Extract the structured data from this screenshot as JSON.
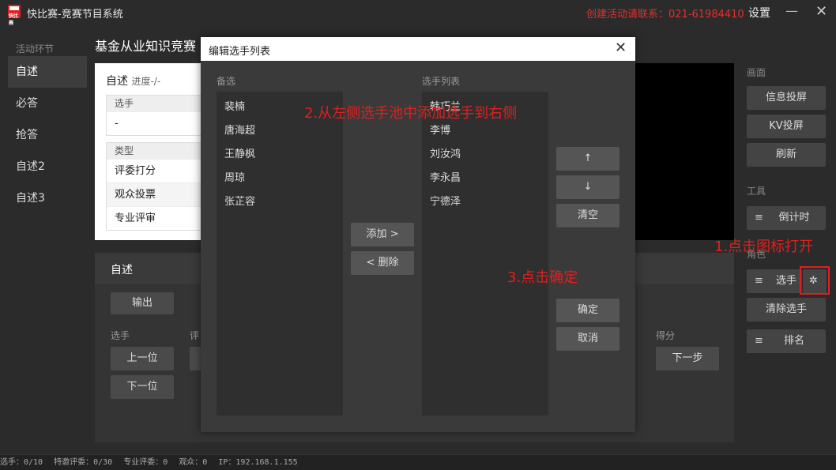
{
  "titlebar": {
    "title": "快比赛-竞赛节目系统",
    "logo_text": "快比赛",
    "contact": "创建活动请联系：021-61984410",
    "settings": "设置",
    "minimize": "—",
    "close": "✕"
  },
  "sidebar": {
    "heading": "活动环节",
    "items": [
      "自述",
      "必答",
      "抢答",
      "自述2",
      "自述3"
    ]
  },
  "main": {
    "competition_title": "基金从业知识竞赛",
    "panel_title": "自述",
    "progress": "进度-/-",
    "player_header": "选手",
    "player_value": "-",
    "type_header": "类型",
    "types": [
      "评委打分",
      "观众投票",
      "专业评审"
    ]
  },
  "bottom": {
    "title": "自述",
    "output": "输出",
    "player_label": "选手",
    "judge_label_partial": "评",
    "prev": "上一位",
    "next": "下一位",
    "score_label": "得分",
    "next_step": "下一步"
  },
  "right": {
    "screen_heading": "画面",
    "info_cast": "信息投屏",
    "kv_cast": "KV投屏",
    "refresh": "刷新",
    "tools_heading": "工具",
    "countdown": "倒计时",
    "role_heading": "角色",
    "players": "选手",
    "clear_players": "清除选手",
    "ranking": "排名",
    "hamburger": "≡",
    "gear": "✲"
  },
  "modal": {
    "title": "编辑选手列表",
    "close": "✕",
    "candidates_label": "备选",
    "candidates": [
      "裴楠",
      "唐海超",
      "王静枫",
      "周琼",
      "张芷容"
    ],
    "selected_label": "选手列表",
    "selected": [
      "韩巧兰",
      "李博",
      "刘汝鸿",
      "李永昌",
      "宁德泽"
    ],
    "add": "添加 >",
    "remove": "< 删除",
    "up": "↑",
    "down": "↓",
    "clear": "清空",
    "ok": "确定",
    "cancel": "取消"
  },
  "annotations": {
    "step1": "1.点击图标打开",
    "step2": "2.从左侧选手池中添加选手到右侧",
    "step3": "3.点击确定"
  },
  "statusbar": {
    "players": "选手：0/10",
    "special_judges": "特邀评委：0/30",
    "pro_judges": "专业评委：0",
    "audience": "观众：0",
    "ip": "IP：192.168.1.155"
  }
}
